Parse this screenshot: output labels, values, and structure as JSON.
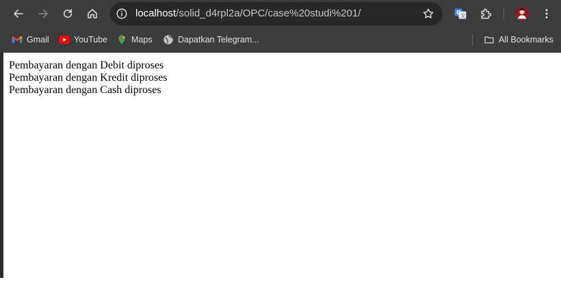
{
  "browser": {
    "url_host": "localhost",
    "url_path": "/solid_d4rpl2a/OPC/case%20studi%201/",
    "icons": {
      "back": "arrow-left-icon",
      "forward": "arrow-right-icon",
      "reload": "reload-icon",
      "home": "home-icon",
      "site_info": "info-icon",
      "bookmark_star": "star-icon",
      "translate": "translate-icon",
      "extensions": "puzzle-icon",
      "profile": "avatar",
      "menu": "kebab-menu-icon"
    }
  },
  "bookmarks_bar": {
    "items": [
      {
        "label": "Gmail",
        "icon": "gmail-icon"
      },
      {
        "label": "YouTube",
        "icon": "youtube-icon"
      },
      {
        "label": "Maps",
        "icon": "maps-icon"
      },
      {
        "label": "Dapatkan Telegram...",
        "icon": "globe-icon"
      }
    ],
    "all_bookmarks": "All Bookmarks"
  },
  "page": {
    "lines": [
      "Pembayaran dengan Debit diproses",
      "Pembayaran dengan Kredit diproses",
      "Pembayaran dengan Cash diproses"
    ]
  },
  "colors": {
    "toolbar_bg": "#3c3c3c",
    "omnibox_bg": "#282828",
    "page_bg": "#ffffff",
    "text": "#000000"
  }
}
